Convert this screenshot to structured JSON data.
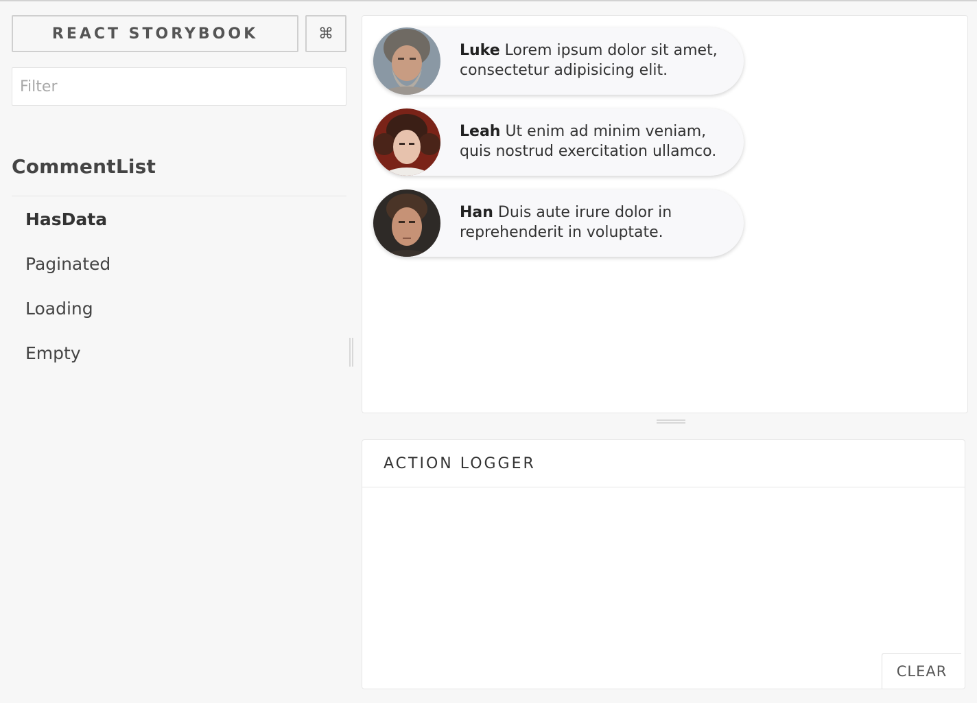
{
  "sidebar": {
    "brand_label": "REACT STORYBOOK",
    "shortcuts_label": "⌘",
    "filter_placeholder": "Filter",
    "filter_value": "",
    "kind": "CommentList",
    "stories": [
      {
        "label": "HasData",
        "selected": true
      },
      {
        "label": "Paginated",
        "selected": false
      },
      {
        "label": "Loading",
        "selected": false
      },
      {
        "label": "Empty",
        "selected": false
      }
    ]
  },
  "preview": {
    "comments": [
      {
        "author": "Luke",
        "text": "Lorem ipsum dolor sit amet, consectetur adipisicing elit.",
        "avatar": "luke-avatar"
      },
      {
        "author": "Leah",
        "text": "Ut enim ad minim veniam, quis nostrud exercitation ullamco.",
        "avatar": "leah-avatar"
      },
      {
        "author": "Han",
        "text": "Duis aute irure dolor in reprehenderit in voluptate.",
        "avatar": "han-avatar"
      }
    ]
  },
  "addon_panel": {
    "tab_label": "ACTION LOGGER",
    "clear_label": "CLEAR"
  },
  "colors": {
    "sidebar_background": "#f7f7f7",
    "panel_background": "#ffffff",
    "border": "#e6e6e6",
    "text": "#333333"
  }
}
